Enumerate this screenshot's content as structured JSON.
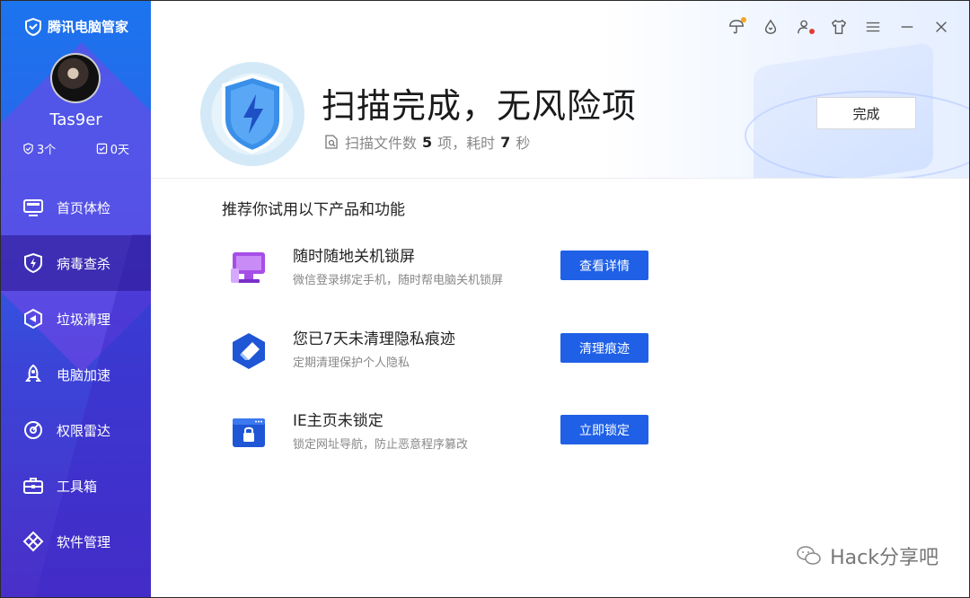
{
  "app": {
    "title": "腾讯电脑管家"
  },
  "user": {
    "name": "Tas9er",
    "stat_count": "3个",
    "stat_days": "0天"
  },
  "nav": [
    {
      "label": "首页体检",
      "icon": "monitor-icon"
    },
    {
      "label": "病毒查杀",
      "icon": "shield-bolt-icon",
      "active": true
    },
    {
      "label": "垃圾清理",
      "icon": "clean-icon"
    },
    {
      "label": "电脑加速",
      "icon": "rocket-icon"
    },
    {
      "label": "权限雷达",
      "icon": "radar-icon"
    },
    {
      "label": "工具箱",
      "icon": "toolbox-icon"
    },
    {
      "label": "软件管理",
      "icon": "software-icon"
    }
  ],
  "header": {
    "title": "扫描完成，无风险项",
    "sub_prefix": "扫描文件数",
    "files_count": "5",
    "sub_mid": "项，耗时",
    "time_value": "7",
    "sub_suffix": "秒",
    "done_button": "完成"
  },
  "recommend": {
    "title": "推荐你试用以下产品和功能",
    "items": [
      {
        "name": "随时随地关机锁屏",
        "desc": "微信登录绑定手机，随时帮电脑关机锁屏",
        "button": "查看详情",
        "icon": "monitor-lock-icon"
      },
      {
        "name": "您已7天未清理隐私痕迹",
        "desc": "定期清理保护个人隐私",
        "button": "清理痕迹",
        "icon": "eraser-icon"
      },
      {
        "name": "IE主页未锁定",
        "desc": "锁定网址导航，防止恶意程序篡改",
        "button": "立即锁定",
        "icon": "browser-lock-icon"
      }
    ]
  },
  "watermark": "Hack分享吧",
  "colors": {
    "accent": "#1f60e6",
    "sidebar_top": "#1c74ee",
    "sidebar_bottom": "#4a2fc8"
  }
}
